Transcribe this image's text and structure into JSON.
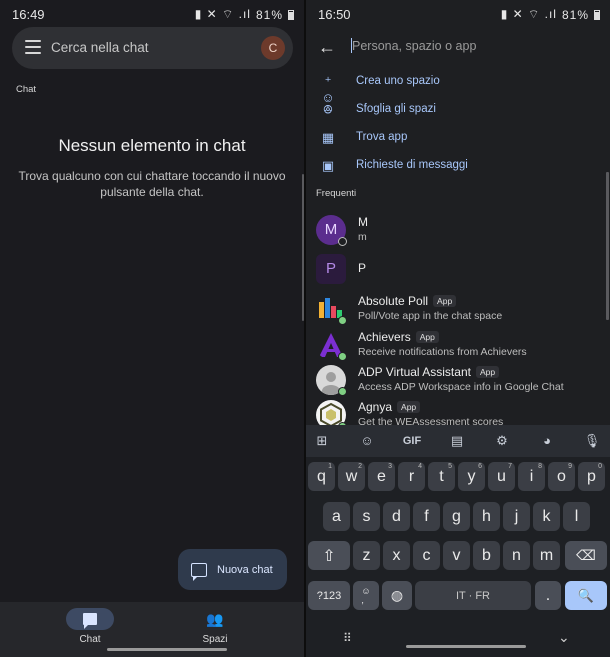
{
  "left": {
    "status": {
      "time": "16:49",
      "battery": "81%",
      "icons": "▮ ✕ ⌔ .ıl"
    },
    "search": {
      "placeholder": "Cerca nella chat",
      "avatar_initial": "C",
      "avatar_color": "#6d3a2b"
    },
    "section_label": "Chat",
    "empty": {
      "title": "Nessun elemento in chat",
      "description": "Trova qualcuno con cui chattare toccando il nuovo pulsante della chat."
    },
    "fab_label": "Nuova chat",
    "nav": [
      {
        "label": "Chat",
        "icon": "chat-icon",
        "active": true
      },
      {
        "label": "Spazi",
        "icon": "people-icon",
        "active": false
      }
    ]
  },
  "right": {
    "status": {
      "time": "16:50",
      "battery": "81%",
      "icons": "▮ ✕ ⌔ .ıl"
    },
    "input_placeholder": "Persona, spazio o app",
    "actions": [
      {
        "label": "Crea uno spazio",
        "icon": "add-people-icon"
      },
      {
        "label": "Sfoglia gli spazi",
        "icon": "browse-spaces-icon"
      },
      {
        "label": "Trova app",
        "icon": "apps-grid-icon"
      },
      {
        "label": "Richieste di messaggi",
        "icon": "message-request-icon"
      }
    ],
    "frequent_label": "Frequenti",
    "contacts": [
      {
        "initial": "M",
        "name": "M",
        "sub": "m",
        "avatar_color": "#5b2d8e",
        "status": "away"
      },
      {
        "initial": "P",
        "name": "P",
        "sub": "",
        "avatar_color": "#2b1b3d",
        "status": "none"
      },
      {
        "name": "Absolute Poll",
        "badge": "App",
        "sub": "Poll/Vote app in the chat space",
        "status": "online"
      },
      {
        "name": "Achievers",
        "badge": "App",
        "sub": "Receive notifications from Achievers",
        "status": "online"
      },
      {
        "name": "ADP Virtual Assistant",
        "badge": "App",
        "sub": "Access ADP Workspace info in Google Chat",
        "status": "online"
      },
      {
        "name": "Agnya",
        "badge": "App",
        "sub": "Get the WEAssessment scores",
        "status": "online"
      }
    ],
    "keyboard": {
      "toolbar": [
        "⊞",
        "☺",
        "GIF",
        "▤",
        "⚙",
        "◕",
        "🎙"
      ],
      "row1": [
        "q",
        "w",
        "e",
        "r",
        "t",
        "y",
        "u",
        "i",
        "o",
        "p"
      ],
      "row1_hints": [
        "1",
        "2",
        "3",
        "4",
        "5",
        "6",
        "7",
        "8",
        "9",
        "0"
      ],
      "row2": [
        "a",
        "s",
        "d",
        "f",
        "g",
        "h",
        "j",
        "k",
        "l"
      ],
      "row3": [
        "z",
        "x",
        "c",
        "v",
        "b",
        "n",
        "m"
      ],
      "shift": "⇧",
      "backspace": "⌫",
      "symbols": "?123",
      "emoji_comma": "☺\n,",
      "globe": "◍",
      "space": "IT · FR",
      "period": ".",
      "search": "🔍"
    }
  }
}
